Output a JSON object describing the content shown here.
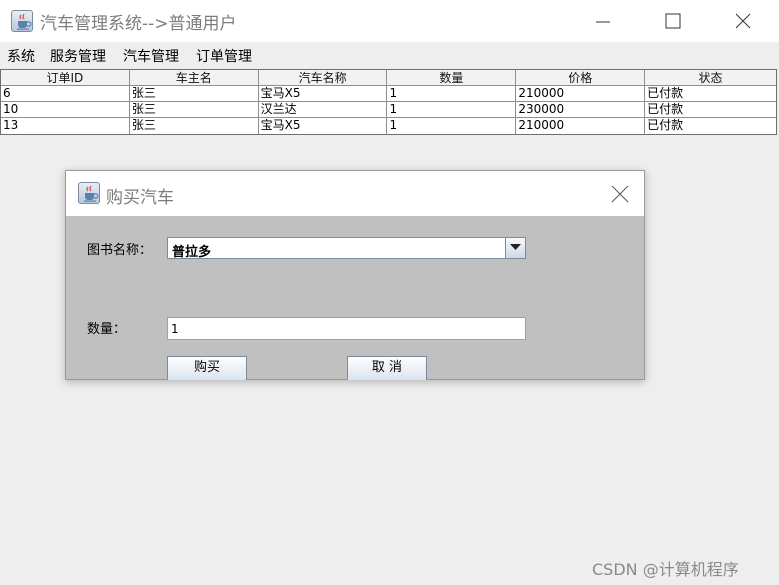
{
  "window": {
    "title": "汽车管理系统-->普通用户",
    "icon": "java-cup-icon"
  },
  "menu": {
    "items": [
      "系统",
      "服务管理",
      "汽车管理",
      "订单管理"
    ]
  },
  "table": {
    "headers": [
      "订单ID",
      "车主名",
      "汽车名称",
      "数量",
      "价格",
      "状态"
    ],
    "rows": [
      [
        "6",
        "张三",
        "宝马X5",
        "1",
        "210000",
        "已付款"
      ],
      [
        "10",
        "张三",
        "汉兰达",
        "1",
        "230000",
        "已付款"
      ],
      [
        "13",
        "张三",
        "宝马X5",
        "1",
        "210000",
        "已付款"
      ]
    ]
  },
  "dialog": {
    "title": "购买汽车",
    "combo_label": "图书名称：",
    "combo_value": "普拉多",
    "qty_label": "数量：",
    "qty_value": "1",
    "buy_label": "购买",
    "cancel_label": "取  消"
  },
  "watermark": "CSDN @计算机程序"
}
